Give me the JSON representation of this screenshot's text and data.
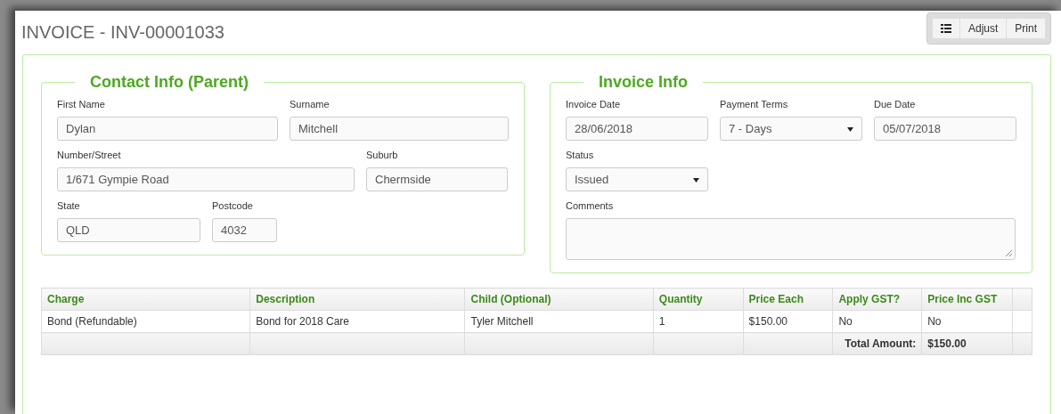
{
  "page_title": "INVOICE - INV-00001033",
  "toolbar": {
    "buttons": [
      {
        "kind": "icon"
      },
      {
        "kind": "text",
        "label": "Adjust"
      },
      {
        "kind": "text",
        "label": "Print"
      }
    ]
  },
  "contact_info": {
    "legend": "Contact Info (Parent)",
    "rows": [
      [
        {
          "kind": "text",
          "label": "First Name",
          "value": "Dylan"
        },
        {
          "kind": "text",
          "label": "Surname",
          "value": "Mitchell"
        }
      ],
      [
        {
          "kind": "text",
          "label": "Number/Street",
          "value": "1/671 Gympie Road"
        },
        {
          "kind": "text",
          "label": "Suburb",
          "value": "Chermside"
        }
      ],
      [
        {
          "kind": "text",
          "label": "State",
          "value": "QLD"
        },
        {
          "kind": "text",
          "label": "Postcode",
          "value": "4032"
        }
      ]
    ]
  },
  "invoice_info": {
    "legend": "Invoice Info",
    "rows": [
      [
        {
          "kind": "text",
          "label": "Invoice Date",
          "value": "28/06/2018"
        },
        {
          "kind": "select",
          "label": "Payment Terms",
          "value": "7 - Days"
        },
        {
          "kind": "text",
          "label": "Due Date",
          "value": "05/07/2018"
        }
      ],
      [
        {
          "kind": "select",
          "label": "Status",
          "value": "Issued"
        }
      ],
      [
        {
          "kind": "textarea",
          "label": "Comments"
        }
      ]
    ]
  },
  "table": {
    "columns": [
      "Charge",
      "Description",
      "Child (Optional)",
      "Quantity",
      "Price Each",
      "Apply GST?",
      "Price Inc GST"
    ],
    "rows": [
      [
        "Bond (Refundable)",
        "Bond for 2018 Care",
        "Tyler Mitchell",
        "1",
        "$150.00",
        "No",
        "No"
      ]
    ],
    "footer": {
      "label": "Total Amount:",
      "value": "$150.00"
    }
  }
}
